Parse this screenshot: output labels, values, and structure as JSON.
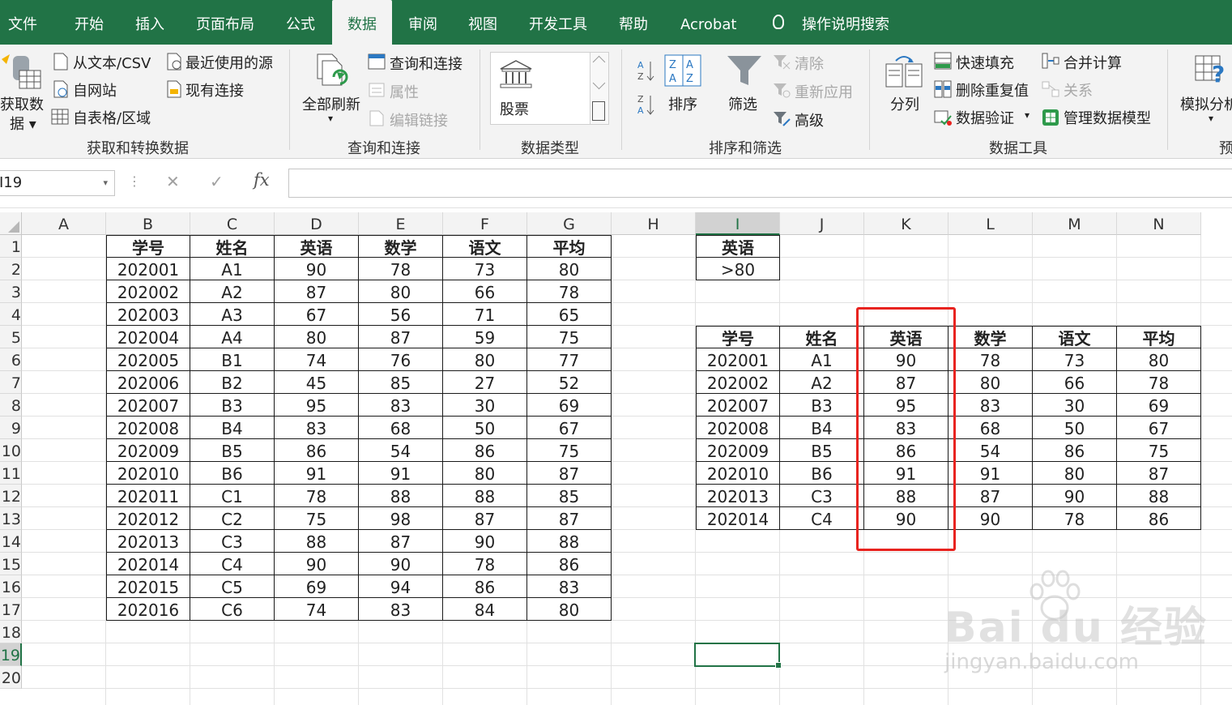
{
  "tabs": [
    "文件",
    "开始",
    "插入",
    "页面布局",
    "公式",
    "数据",
    "审阅",
    "视图",
    "开发工具",
    "帮助",
    "Acrobat",
    "操作说明搜索"
  ],
  "active_tab": "数据",
  "ribbon": {
    "get_data": {
      "label_line1": "获取数",
      "label_line2": "据 ▾",
      "from_text_csv": "从文本/CSV",
      "from_web": "自网站",
      "from_table": "自表格/区域",
      "recent_sources": "最近使用的源",
      "existing_connections": "现有连接",
      "group": "获取和转换数据"
    },
    "queries": {
      "refresh_all": "全部刷新",
      "refresh_arrow": "▾",
      "queries_connections": "查询和连接",
      "properties": "属性",
      "edit_links": "编辑链接",
      "group": "查询和连接"
    },
    "data_types": {
      "stocks": "股票",
      "group": "数据类型"
    },
    "sort_filter": {
      "sort": "排序",
      "filter": "筛选",
      "clear": "清除",
      "reapply": "重新应用",
      "advanced": "高级",
      "group": "排序和筛选"
    },
    "data_tools": {
      "text_to_columns": "分列",
      "flash_fill": "快速填充",
      "remove_duplicates": "删除重复值",
      "data_validation": "数据验证",
      "consolidate": "合并计算",
      "relationships": "关系",
      "manage_data_model": "管理数据模型",
      "group": "数据工具"
    },
    "forecast": {
      "what_if": "模拟分析",
      "group": "预"
    }
  },
  "formula_bar": {
    "name_box": "I19",
    "fx": "fx"
  },
  "columns": [
    "A",
    "B",
    "C",
    "D",
    "E",
    "F",
    "G",
    "H",
    "I",
    "J",
    "K",
    "L",
    "M",
    "N"
  ],
  "rows": [
    "1",
    "2",
    "3",
    "4",
    "5",
    "6",
    "7",
    "8",
    "9",
    "10",
    "11",
    "12",
    "13",
    "14",
    "15",
    "16",
    "17",
    "18",
    "19",
    "20"
  ],
  "selected_cell": {
    "col": "I",
    "row": "19"
  },
  "left_table": {
    "headers": [
      "学号",
      "姓名",
      "英语",
      "数学",
      "语文",
      "平均"
    ],
    "rows": [
      [
        "202001",
        "A1",
        "90",
        "78",
        "73",
        "80"
      ],
      [
        "202002",
        "A2",
        "87",
        "80",
        "66",
        "78"
      ],
      [
        "202003",
        "A3",
        "67",
        "56",
        "71",
        "65"
      ],
      [
        "202004",
        "A4",
        "80",
        "87",
        "59",
        "75"
      ],
      [
        "202005",
        "B1",
        "74",
        "76",
        "80",
        "77"
      ],
      [
        "202006",
        "B2",
        "45",
        "85",
        "27",
        "52"
      ],
      [
        "202007",
        "B3",
        "95",
        "83",
        "30",
        "69"
      ],
      [
        "202008",
        "B4",
        "83",
        "68",
        "50",
        "67"
      ],
      [
        "202009",
        "B5",
        "86",
        "54",
        "86",
        "75"
      ],
      [
        "202010",
        "B6",
        "91",
        "91",
        "80",
        "87"
      ],
      [
        "202011",
        "C1",
        "78",
        "88",
        "88",
        "85"
      ],
      [
        "202012",
        "C2",
        "75",
        "98",
        "87",
        "87"
      ],
      [
        "202013",
        "C3",
        "88",
        "87",
        "90",
        "88"
      ],
      [
        "202014",
        "C4",
        "90",
        "90",
        "78",
        "86"
      ],
      [
        "202015",
        "C5",
        "69",
        "94",
        "86",
        "83"
      ],
      [
        "202016",
        "C6",
        "74",
        "83",
        "84",
        "80"
      ]
    ]
  },
  "criteria": {
    "header": "英语",
    "value": ">80"
  },
  "result_table": {
    "headers": [
      "学号",
      "姓名",
      "英语",
      "数学",
      "语文",
      "平均"
    ],
    "rows": [
      [
        "202001",
        "A1",
        "90",
        "78",
        "73",
        "80"
      ],
      [
        "202002",
        "A2",
        "87",
        "80",
        "66",
        "78"
      ],
      [
        "202007",
        "B3",
        "95",
        "83",
        "30",
        "69"
      ],
      [
        "202008",
        "B4",
        "83",
        "68",
        "50",
        "67"
      ],
      [
        "202009",
        "B5",
        "86",
        "54",
        "86",
        "75"
      ],
      [
        "202010",
        "B6",
        "91",
        "91",
        "80",
        "87"
      ],
      [
        "202013",
        "C3",
        "88",
        "87",
        "90",
        "88"
      ],
      [
        "202014",
        "C4",
        "90",
        "90",
        "78",
        "86"
      ]
    ]
  },
  "watermark": {
    "brand": "Bai du 经验",
    "url": "jingyan.baidu.com"
  },
  "colors": {
    "accent": "#217346",
    "highlight_box": "#e8231f"
  }
}
